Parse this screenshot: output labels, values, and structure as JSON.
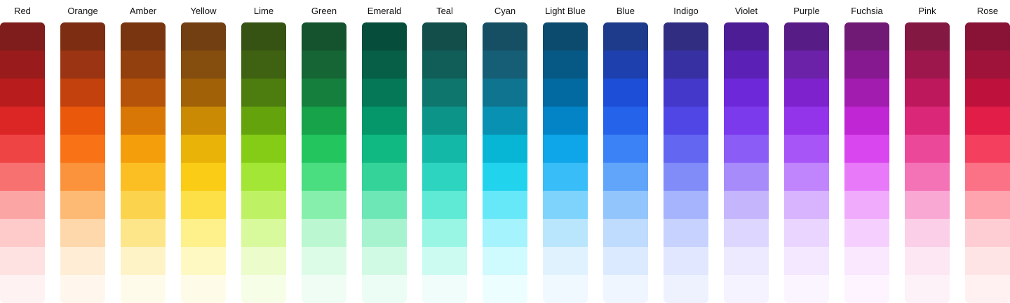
{
  "palette": [
    {
      "name": "Red",
      "shades": [
        "#7f1d1d",
        "#991b1b",
        "#b91c1c",
        "#dc2626",
        "#ef4444",
        "#f87171",
        "#fca5a5",
        "#fecaca",
        "#fee2e2",
        "#fef2f2"
      ]
    },
    {
      "name": "Orange",
      "shades": [
        "#7c2d12",
        "#9a3412",
        "#c2410c",
        "#ea580c",
        "#f97316",
        "#fb923c",
        "#fdba74",
        "#fed7aa",
        "#ffedd5",
        "#fff7ed"
      ]
    },
    {
      "name": "Amber",
      "shades": [
        "#78350f",
        "#92400e",
        "#b45309",
        "#d97706",
        "#f59e0b",
        "#fbbf24",
        "#fcd34d",
        "#fde68a",
        "#fef3c7",
        "#fffbeb"
      ]
    },
    {
      "name": "Yellow",
      "shades": [
        "#713f12",
        "#854d0e",
        "#a16207",
        "#ca8a04",
        "#eab308",
        "#facc15",
        "#fde047",
        "#fef08a",
        "#fef9c3",
        "#fefce8"
      ]
    },
    {
      "name": "Lime",
      "shades": [
        "#365314",
        "#3f6212",
        "#4d7c0f",
        "#65a30d",
        "#84cc16",
        "#a3e635",
        "#bef264",
        "#d9f99d",
        "#ecfccb",
        "#f7fee7"
      ]
    },
    {
      "name": "Green",
      "shades": [
        "#14532d",
        "#166534",
        "#15803d",
        "#16a34a",
        "#22c55e",
        "#4ade80",
        "#86efac",
        "#bbf7d0",
        "#dcfce7",
        "#f0fdf4"
      ]
    },
    {
      "name": "Emerald",
      "shades": [
        "#064e3b",
        "#065f46",
        "#047857",
        "#059669",
        "#10b981",
        "#34d399",
        "#6ee7b7",
        "#a7f3d0",
        "#d1fae5",
        "#ecfdf5"
      ]
    },
    {
      "name": "Teal",
      "shades": [
        "#134e4a",
        "#115e59",
        "#0f766e",
        "#0d9488",
        "#14b8a6",
        "#2dd4bf",
        "#5eead4",
        "#99f6e4",
        "#ccfbf1",
        "#f0fdfa"
      ]
    },
    {
      "name": "Cyan",
      "shades": [
        "#164e63",
        "#155e75",
        "#0e7490",
        "#0891b2",
        "#06b6d4",
        "#22d3ee",
        "#67e8f9",
        "#a5f3fc",
        "#cffafe",
        "#ecfeff"
      ]
    },
    {
      "name": "Light Blue",
      "shades": [
        "#0c4a6e",
        "#075985",
        "#0369a1",
        "#0284c7",
        "#0ea5e9",
        "#38bdf8",
        "#7dd3fc",
        "#bae6fd",
        "#e0f2fe",
        "#f0f9ff"
      ]
    },
    {
      "name": "Blue",
      "shades": [
        "#1e3a8a",
        "#1e40af",
        "#1d4ed8",
        "#2563eb",
        "#3b82f6",
        "#60a5fa",
        "#93c5fd",
        "#bfdbfe",
        "#dbeafe",
        "#eff6ff"
      ]
    },
    {
      "name": "Indigo",
      "shades": [
        "#312e81",
        "#3730a3",
        "#4338ca",
        "#4f46e5",
        "#6366f1",
        "#818cf8",
        "#a5b4fc",
        "#c7d2fe",
        "#e0e7ff",
        "#eef2ff"
      ]
    },
    {
      "name": "Violet",
      "shades": [
        "#4c1d95",
        "#5b21b6",
        "#6d28d9",
        "#7c3aed",
        "#8b5cf6",
        "#a78bfa",
        "#c4b5fd",
        "#ddd6fe",
        "#ede9fe",
        "#f5f3ff"
      ]
    },
    {
      "name": "Purple",
      "shades": [
        "#581c87",
        "#6b21a8",
        "#7e22ce",
        "#9333ea",
        "#a855f7",
        "#c084fc",
        "#d8b4fe",
        "#e9d5ff",
        "#f3e8ff",
        "#faf5ff"
      ]
    },
    {
      "name": "Fuchsia",
      "shades": [
        "#701a75",
        "#86198f",
        "#a21caf",
        "#c026d3",
        "#d946ef",
        "#e879f9",
        "#f0abfc",
        "#f5d0fe",
        "#fae8ff",
        "#fdf4ff"
      ]
    },
    {
      "name": "Pink",
      "shades": [
        "#831843",
        "#9d174d",
        "#be185d",
        "#db2777",
        "#ec4899",
        "#f472b6",
        "#f9a8d4",
        "#fbcfe8",
        "#fce7f3",
        "#fdf2f8"
      ]
    },
    {
      "name": "Rose",
      "shades": [
        "#881337",
        "#9f1239",
        "#be123c",
        "#e11d48",
        "#f43f5e",
        "#fb7185",
        "#fda4af",
        "#fecdd3",
        "#ffe4e6",
        "#fff1f2"
      ]
    }
  ]
}
